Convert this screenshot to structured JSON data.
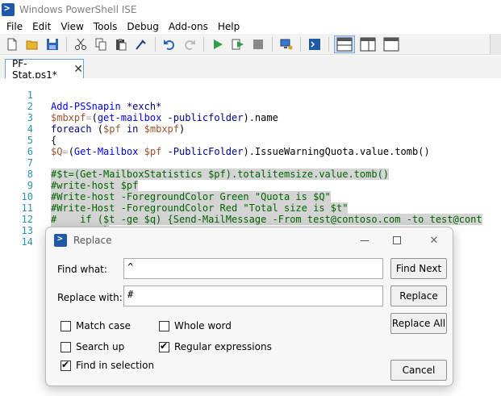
{
  "window": {
    "title": "Windows PowerShell ISE"
  },
  "menu": [
    "File",
    "Edit",
    "View",
    "Tools",
    "Debug",
    "Add-ons",
    "Help"
  ],
  "toolbar_icons": [
    "new-icon",
    "open-icon",
    "save-icon",
    "cut-icon",
    "copy-icon",
    "paste-icon",
    "clear-icon",
    "undo-icon",
    "redo-icon",
    "run-icon",
    "run-selection-icon",
    "stop-icon",
    "remote-icon",
    "console-icon",
    "layout-top-icon",
    "layout-right-icon",
    "layout-max-icon"
  ],
  "tab": {
    "label": "PF-Stat.ps1*",
    "close": "✕"
  },
  "editor": {
    "line_numbers": [
      "1",
      "2",
      "3",
      "4",
      "5",
      "6",
      "7",
      "8",
      "9",
      "10",
      "11",
      "12",
      "13",
      "14"
    ],
    "lines": [
      "Add-PSSnapin *exch*",
      "$mbxpf=(get-mailbox -publicfolder).name",
      "foreach ($pf in $mbxpf)",
      "{",
      "$Q=(Get-Mailbox $pf -PublicFolder).IssueWarningQuota.value.tomb()",
      "",
      "#$t=(Get-MailboxStatistics $pf).totalitemsize.value.tomb()",
      "#write-host $pf",
      "#Write-host -ForegroundColor Green \"Quota is $Q\"",
      "#Write-Host -ForegroundColor Red \"Total size is $t\"",
      "#    if ($t -ge $q) {Send-MailMessage -From test@contoso.com -to test@cont",
      "#        }",
      "",
      ""
    ]
  },
  "dialog": {
    "title": "Replace",
    "find_label": "Find what:",
    "find_value": "^",
    "replace_label": "Replace with:",
    "replace_value": "#",
    "find_next": "Find Next",
    "replace": "Replace",
    "replace_all": "Replace All",
    "cancel": "Cancel",
    "options": {
      "match_case": {
        "label": "Match case",
        "checked": false
      },
      "whole_word": {
        "label": "Whole word",
        "checked": false
      },
      "search_up": {
        "label": "Search up",
        "checked": false
      },
      "regex": {
        "label": "Regular expressions",
        "checked": true
      },
      "in_selection": {
        "label": "Find in selection",
        "checked": true
      }
    }
  }
}
